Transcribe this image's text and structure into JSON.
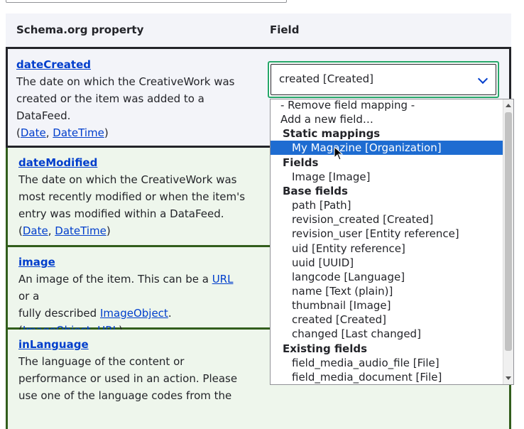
{
  "table": {
    "header_property": "Schema.org property",
    "header_field": "Field"
  },
  "rows": [
    {
      "name": "dateCreated",
      "desc1": "The date on which the CreativeWork was",
      "desc2": "created or the item was added to a",
      "desc3": "DataFeed.",
      "type1": "Date",
      "type2": "DateTime"
    },
    {
      "name": "dateModified",
      "desc1": "The date on which the CreativeWork was",
      "desc2": "most recently modified or when the item's",
      "desc3": "entry was modified within a DataFeed.",
      "type1": "Date",
      "type2": "DateTime"
    },
    {
      "name": "image",
      "desc1_pre": "An image of the item. This can be a ",
      "desc1_link": "URL",
      "desc1_post": " or a",
      "desc2_pre": "fully described ",
      "desc2_link": "ImageObject",
      "desc2_post": ".",
      "type1": "ImageObject",
      "type2": "URL"
    },
    {
      "name": "inLanguage",
      "desc1": "The language of the content or",
      "desc2": "performance or used in an action. Please",
      "desc3": "use one of the language codes from the"
    }
  ],
  "select": {
    "value": "created [Created]"
  },
  "dropdown": {
    "options": [
      {
        "label": "- Remove field mapping -",
        "kind": "lvl1"
      },
      {
        "label": "Add a new field…",
        "kind": "lvl1"
      },
      {
        "label": "Static mappings",
        "kind": "group"
      },
      {
        "label": "My Magazine [Organization]",
        "kind": "lvl2 hl"
      },
      {
        "label": "Fields",
        "kind": "group"
      },
      {
        "label": "Image [Image]",
        "kind": "lvl2"
      },
      {
        "label": "Base fields",
        "kind": "group"
      },
      {
        "label": "path [Path]",
        "kind": "lvl2"
      },
      {
        "label": "revision_created [Created]",
        "kind": "lvl2"
      },
      {
        "label": "revision_user [Entity reference]",
        "kind": "lvl2"
      },
      {
        "label": "uid [Entity reference]",
        "kind": "lvl2"
      },
      {
        "label": "uuid [UUID]",
        "kind": "lvl2"
      },
      {
        "label": "langcode [Language]",
        "kind": "lvl2"
      },
      {
        "label": "name [Text (plain)]",
        "kind": "lvl2"
      },
      {
        "label": "thumbnail [Image]",
        "kind": "lvl2"
      },
      {
        "label": "created [Created]",
        "kind": "lvl2"
      },
      {
        "label": "changed [Last changed]",
        "kind": "lvl2"
      },
      {
        "label": "Existing fields",
        "kind": "group"
      },
      {
        "label": "field_media_audio_file [File]",
        "kind": "lvl2"
      },
      {
        "label": "field_media_document [File]",
        "kind": "lvl2"
      }
    ]
  }
}
